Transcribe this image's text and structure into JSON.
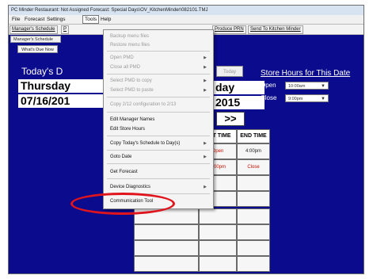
{
  "window": {
    "title": "PC Minder    Restaurant: Not Assigned    Forecast: Special Days\\OV_KitchenMinder\\082101.TMJ"
  },
  "menubar": {
    "items": [
      {
        "label": "File"
      },
      {
        "label": "Forecast"
      },
      {
        "label": "Settings"
      },
      {
        "label": "Tools"
      },
      {
        "label": "Help"
      }
    ]
  },
  "toolbar": {
    "managers_schedule": "Manager's Schedule",
    "p_partial": "P",
    "produce_prn": "Produce PRN",
    "send_to_kitchen": "Send To Kitchen Minder"
  },
  "sidebar": {
    "tab_label": "Manager's Schedule",
    "whats_due_now": "What's Due Now"
  },
  "schedule": {
    "todays_label": "Today's D",
    "day_left": "Thursday",
    "date_left": "07/16/201",
    "tiny_button": "Today",
    "day_right": "day",
    "year_right": "2015",
    "next_button": ">>",
    "start_time_header": "ART TIME",
    "end_time_header": "END TIME",
    "row1_start": "Open",
    "row1_end": "4:00pm",
    "row2_start": "4:00pm",
    "row2_end": "Close"
  },
  "store_hours": {
    "title": "Store Hours for This Date",
    "open_label": "Open",
    "open_value": "10:00am",
    "close_label": "Close",
    "close_value": "9:00pm"
  },
  "tools_menu": {
    "items": [
      {
        "label": "Backup menu files",
        "enabled": false,
        "submenu": false
      },
      {
        "label": "Restore menu files",
        "enabled": false,
        "submenu": false
      },
      {
        "label": "Open PMD",
        "enabled": false,
        "submenu": true
      },
      {
        "label": "Close all PMD",
        "enabled": false,
        "submenu": true
      },
      {
        "label": "Select PMD to copy",
        "enabled": false,
        "submenu": true
      },
      {
        "label": "Select PMD to paste",
        "enabled": false,
        "submenu": true
      },
      {
        "label": "Copy 2/12 configuration to 2/13",
        "enabled": false,
        "submenu": false
      },
      {
        "label": "Edit Manager Names",
        "enabled": true,
        "submenu": false
      },
      {
        "label": "Edit Store Hours",
        "enabled": true,
        "submenu": false
      },
      {
        "label": "Copy Today's Schedule to Day(s)",
        "enabled": true,
        "submenu": true
      },
      {
        "label": "Goto Date",
        "enabled": true,
        "submenu": true
      },
      {
        "label": "Get Forecast",
        "enabled": true,
        "submenu": false
      },
      {
        "label": "Device Diagnostics",
        "enabled": true,
        "submenu": true
      },
      {
        "label": "Communication Tool",
        "enabled": true,
        "submenu": false
      }
    ]
  },
  "colors": {
    "app_background": "#0b0b8e",
    "highlight_ring": "#e0141c",
    "red_text": "#cc1100"
  }
}
